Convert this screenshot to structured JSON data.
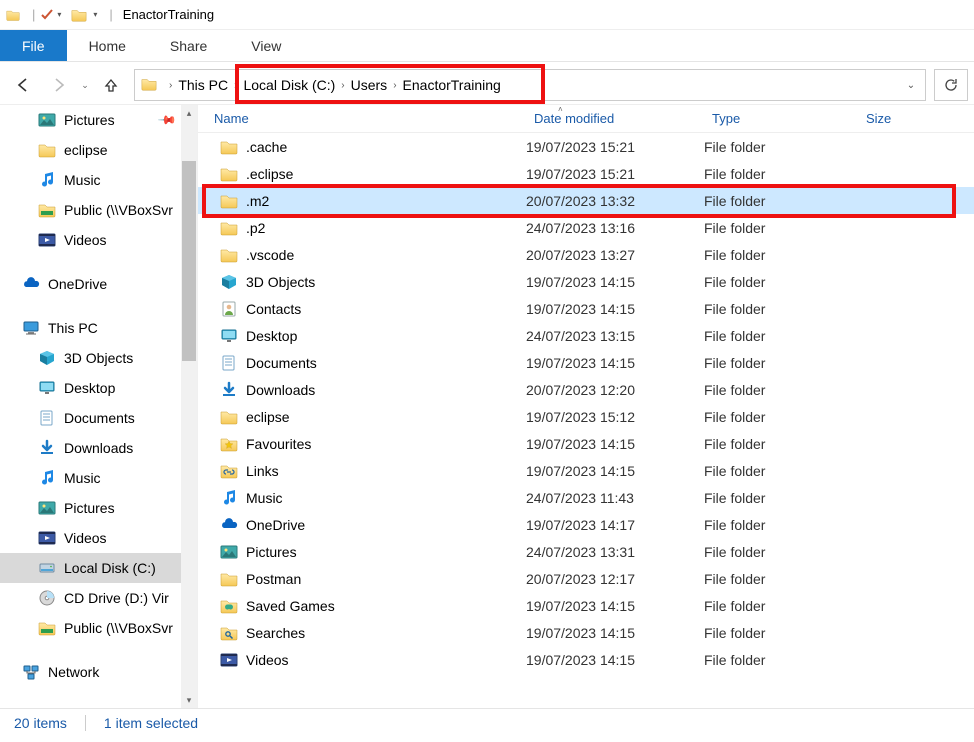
{
  "window": {
    "title": "EnactorTraining"
  },
  "ribbon": {
    "file": "File",
    "home": "Home",
    "share": "Share",
    "view": "View"
  },
  "breadcrumb": {
    "root": "This PC",
    "parts": [
      "Local Disk (C:)",
      "Users",
      "EnactorTraining"
    ]
  },
  "columns": {
    "name": "Name",
    "date": "Date modified",
    "type": "Type",
    "size": "Size"
  },
  "navpane": {
    "items": [
      {
        "label": "Pictures",
        "icon": "pictures",
        "pinned": true,
        "lvl": 1
      },
      {
        "label": "eclipse",
        "icon": "folder",
        "lvl": 1
      },
      {
        "label": "Music",
        "icon": "music",
        "lvl": 1
      },
      {
        "label": "Public (\\\\VBoxSvr",
        "icon": "netfolder",
        "lvl": 1
      },
      {
        "label": "Videos",
        "icon": "videos",
        "lvl": 1
      },
      {
        "spacer": true
      },
      {
        "label": "OneDrive",
        "icon": "onedrive",
        "lvl": 0
      },
      {
        "spacer": true
      },
      {
        "label": "This PC",
        "icon": "thispc",
        "lvl": 0
      },
      {
        "label": "3D Objects",
        "icon": "3dobjects",
        "lvl": 1
      },
      {
        "label": "Desktop",
        "icon": "desktop",
        "lvl": 1
      },
      {
        "label": "Documents",
        "icon": "documents",
        "lvl": 1
      },
      {
        "label": "Downloads",
        "icon": "downloads",
        "lvl": 1
      },
      {
        "label": "Music",
        "icon": "music",
        "lvl": 1
      },
      {
        "label": "Pictures",
        "icon": "pictures",
        "lvl": 1
      },
      {
        "label": "Videos",
        "icon": "videos",
        "lvl": 1
      },
      {
        "label": "Local Disk (C:)",
        "icon": "disk",
        "lvl": 1,
        "selected": true
      },
      {
        "label": "CD Drive (D:) Vir",
        "icon": "cddrive",
        "lvl": 1
      },
      {
        "label": "Public (\\\\VBoxSvr",
        "icon": "netfolder",
        "lvl": 1
      },
      {
        "spacer": true
      },
      {
        "label": "Network",
        "icon": "network",
        "lvl": 0
      }
    ]
  },
  "files": [
    {
      "name": ".cache",
      "date": "19/07/2023 15:21",
      "type": "File folder",
      "icon": "folder"
    },
    {
      "name": ".eclipse",
      "date": "19/07/2023 15:21",
      "type": "File folder",
      "icon": "folder"
    },
    {
      "name": ".m2",
      "date": "20/07/2023 13:32",
      "type": "File folder",
      "icon": "folder",
      "selected": true,
      "highlighted": true
    },
    {
      "name": ".p2",
      "date": "24/07/2023 13:16",
      "type": "File folder",
      "icon": "folder"
    },
    {
      "name": ".vscode",
      "date": "20/07/2023 13:27",
      "type": "File folder",
      "icon": "folder"
    },
    {
      "name": "3D Objects",
      "date": "19/07/2023 14:15",
      "type": "File folder",
      "icon": "3dobjects"
    },
    {
      "name": "Contacts",
      "date": "19/07/2023 14:15",
      "type": "File folder",
      "icon": "contacts"
    },
    {
      "name": "Desktop",
      "date": "24/07/2023 13:15",
      "type": "File folder",
      "icon": "desktop"
    },
    {
      "name": "Documents",
      "date": "19/07/2023 14:15",
      "type": "File folder",
      "icon": "documents"
    },
    {
      "name": "Downloads",
      "date": "20/07/2023 12:20",
      "type": "File folder",
      "icon": "downloads"
    },
    {
      "name": "eclipse",
      "date": "19/07/2023 15:12",
      "type": "File folder",
      "icon": "folder"
    },
    {
      "name": "Favourites",
      "date": "19/07/2023 14:15",
      "type": "File folder",
      "icon": "favorites"
    },
    {
      "name": "Links",
      "date": "19/07/2023 14:15",
      "type": "File folder",
      "icon": "links"
    },
    {
      "name": "Music",
      "date": "24/07/2023 11:43",
      "type": "File folder",
      "icon": "music"
    },
    {
      "name": "OneDrive",
      "date": "19/07/2023 14:17",
      "type": "File folder",
      "icon": "onedrive"
    },
    {
      "name": "Pictures",
      "date": "24/07/2023 13:31",
      "type": "File folder",
      "icon": "pictures"
    },
    {
      "name": "Postman",
      "date": "20/07/2023 12:17",
      "type": "File folder",
      "icon": "folder"
    },
    {
      "name": "Saved Games",
      "date": "19/07/2023 14:15",
      "type": "File folder",
      "icon": "savedgames"
    },
    {
      "name": "Searches",
      "date": "19/07/2023 14:15",
      "type": "File folder",
      "icon": "searches"
    },
    {
      "name": "Videos",
      "date": "19/07/2023 14:15",
      "type": "File folder",
      "icon": "videos"
    }
  ],
  "status": {
    "count": "20 items",
    "selection": "1 item selected"
  }
}
